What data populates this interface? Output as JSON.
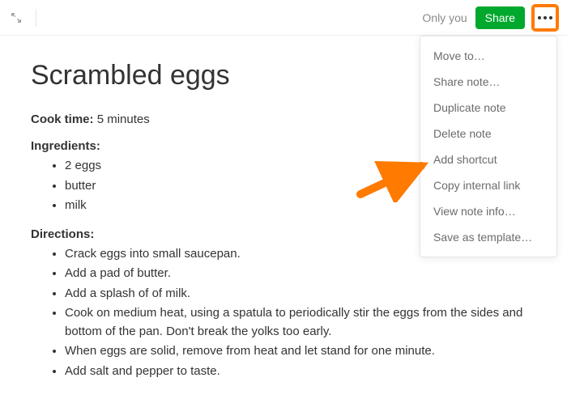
{
  "header": {
    "visibility_label": "Only you",
    "share_label": "Share"
  },
  "menu": {
    "items": [
      "Move to…",
      "Share note…",
      "Duplicate note",
      "Delete note",
      "Add shortcut",
      "Copy internal link",
      "View note info…",
      "Save as template…"
    ]
  },
  "note": {
    "title": "Scrambled eggs",
    "cook_time_label": "Cook time:",
    "cook_time_value": "5 minutes",
    "ingredients_label": "Ingredients:",
    "ingredients": [
      "2 eggs",
      "butter",
      "milk"
    ],
    "directions_label": "Directions:",
    "directions": [
      "Crack eggs into small saucepan.",
      "Add a pad of butter.",
      "Add a splash of of milk.",
      "Cook on medium heat, using a spatula to periodically stir the eggs from the sides and bottom of the pan. Don't break the yolks too early.",
      "When eggs are solid, remove from heat and let stand for one minute.",
      "Add salt and pepper to taste."
    ]
  },
  "annotation": {
    "arrow_color": "#ff7a00",
    "highlight_color": "#ff7a00"
  }
}
